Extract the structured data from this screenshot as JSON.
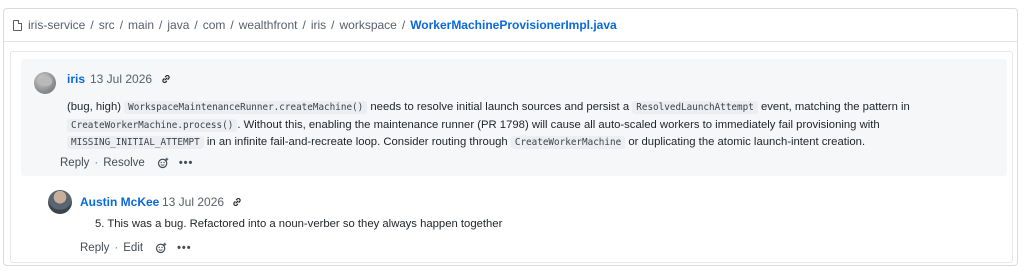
{
  "breadcrumb": {
    "parts": [
      "iris-service",
      "src",
      "main",
      "java",
      "com",
      "wealthfront",
      "iris",
      "workspace"
    ],
    "current": "WorkerMachineProvisionerImpl.java"
  },
  "comment1": {
    "author": "iris",
    "date": "13 Jul 2026",
    "body": {
      "t1": "(bug, high)",
      "c1": "WorkspaceMaintenanceRunner.createMachine()",
      "t2": "needs to resolve initial launch sources and persist a",
      "c2": "ResolvedLaunchAttempt",
      "t3": "event, matching the pattern in",
      "c3": "CreateWorkerMachine.process()",
      "t4": ". Without this, enabling the maintenance runner (PR 1798) will cause all auto-scaled workers to immediately fail provisioning with",
      "c4": "MISSING_INITIAL_ATTEMPT",
      "t5": "in an infinite fail-and-recreate loop. Consider routing through",
      "c5": "CreateWorkerMachine",
      "t6": "or duplicating the atomic launch-intent creation."
    },
    "actions": {
      "reply": "Reply",
      "separator": "·",
      "second": "Resolve",
      "more": "•••"
    }
  },
  "comment2": {
    "author": "Austin McKee",
    "date": "13 Jul 2026",
    "body": "5. This was a bug. Refactored into a noun-verber so they always happen together",
    "actions": {
      "reply": "Reply",
      "separator": "·",
      "second": "Edit",
      "more": "•••"
    }
  },
  "icons": [
    "file-icon",
    "link-icon",
    "emoji-icon",
    "more-icon"
  ],
  "colors": {
    "link": "#0969da",
    "muted": "#57606a",
    "comment_bg": "#f6f7f9"
  }
}
